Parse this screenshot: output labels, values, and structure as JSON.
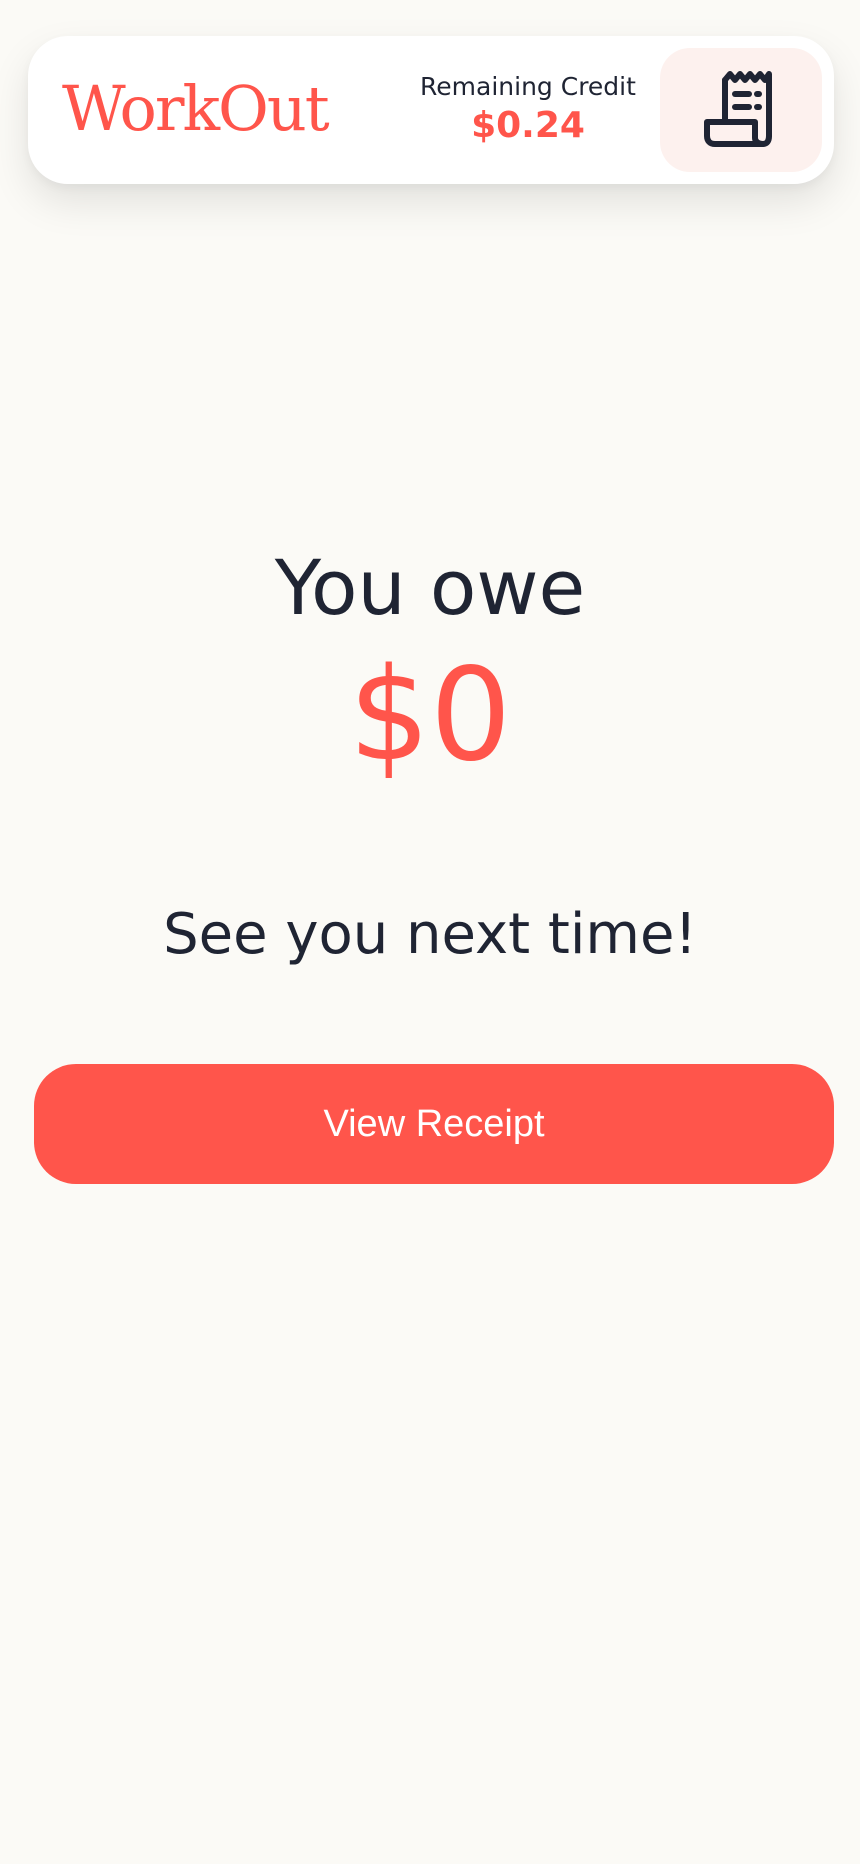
{
  "header": {
    "logo": "WorkOut",
    "credit_label": "Remaining Credit",
    "credit_value": "$0.24",
    "receipt_icon": "receipt-icon"
  },
  "main": {
    "owe_label": "You owe",
    "owe_amount": "$0",
    "farewell": "See you next time!",
    "view_receipt_label": "View Receipt"
  },
  "colors": {
    "accent": "#ff554b",
    "text": "#1f2433",
    "background": "#fbfaf6",
    "icon_button_bg": "#fdf1ee"
  }
}
